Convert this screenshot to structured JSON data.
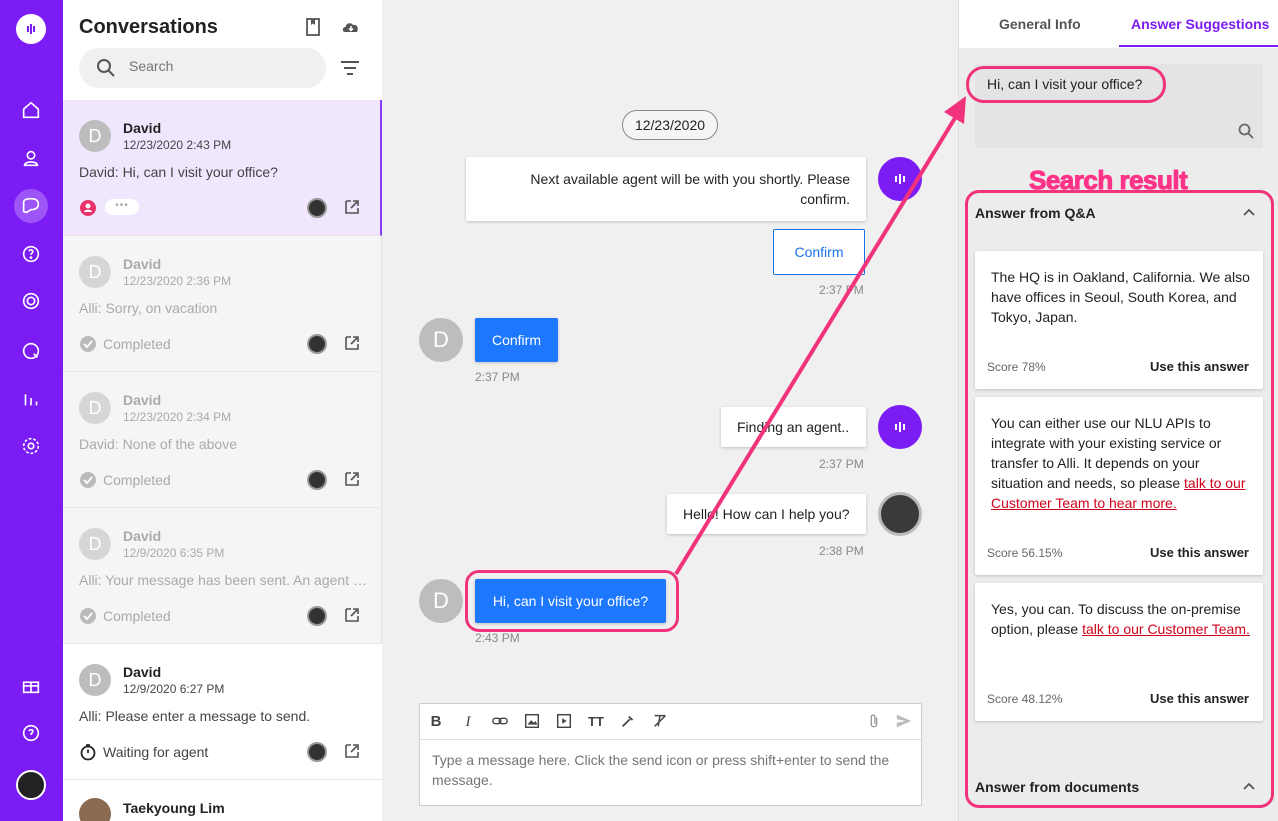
{
  "rail": {
    "icons": [
      "logo-icon",
      "home-icon",
      "user-icon",
      "conversations-icon",
      "help-bubble-icon",
      "target-icon",
      "search-chat-icon",
      "bar-chart-icon",
      "gear-icon",
      "gift-icon",
      "help-icon",
      "avatar"
    ]
  },
  "conversations": {
    "title": "Conversations",
    "search_placeholder": "Search",
    "items": [
      {
        "avatar": "D",
        "name": "David",
        "time": "12/23/2020 2:43 PM",
        "message": "David: Hi, can I visit your office?",
        "status": "",
        "typing": "•••"
      },
      {
        "avatar": "D",
        "name": "David",
        "time": "12/23/2020 2:36 PM",
        "message": "Alli: Sorry, on vacation",
        "status": "Completed"
      },
      {
        "avatar": "D",
        "name": "David",
        "time": "12/23/2020 2:34 PM",
        "message": "David: None of the above",
        "status": "Completed"
      },
      {
        "avatar": "D",
        "name": "David",
        "time": "12/9/2020 6:35 PM",
        "message": "Alli: Your message has been sent. An agent will be with you shortly.",
        "status": "Completed"
      },
      {
        "avatar": "D",
        "name": "David",
        "time": "12/9/2020 6:27 PM",
        "message": "Alli: Please enter a message to send.",
        "status": "Waiting for agent"
      },
      {
        "name": "Taekyoung Lim"
      }
    ]
  },
  "chat": {
    "date": "12/23/2020",
    "bot_msg_1": "Next available agent will be with you shortly. Please confirm.",
    "confirm_option": "Confirm",
    "ts_1": "2:37 PM",
    "user_avatar": "D",
    "user_confirm": "Confirm",
    "ts_2": "2:37 PM",
    "bot_msg_2": "Finding an agent..",
    "ts_3": "2:37 PM",
    "agent_msg": "Hello! How can I help you?",
    "ts_4": "2:38 PM",
    "user_msg": "Hi, can I visit your office?",
    "ts_5": "2:43 PM",
    "composer_placeholder": "Type a message here. Click the send icon or press shift+enter to send the message."
  },
  "side": {
    "tab_general": "General Info",
    "tab_suggestions": "Answer Suggestions",
    "query": "Hi, can I visit your office?",
    "annotation_label": "Search result",
    "qa_header": "Answer from Q&A",
    "docs_header": "Answer from documents",
    "use_label": "Use this answer",
    "answers": [
      {
        "text": "The HQ is in Oakland, California. We also have offices in Seoul, South Korea, and Tokyo, Japan.",
        "link": "",
        "score": "Score 78%"
      },
      {
        "text": "You can either use our NLU APIs to integrate with your existing service or transfer to Alli. It depends on your situation and needs, so please ",
        "link": "talk to our Customer Team to hear more.",
        "score": "Score 56.15%"
      },
      {
        "text": "Yes, you can. To discuss the on-premise option, please ",
        "link": "talk to our Customer Team.",
        "score": "Score 48.12%"
      }
    ]
  },
  "colors": {
    "brand": "#7c1cf5",
    "primary_blue": "#1e78ff",
    "annotation": "#f0337a",
    "link_red": "#d0021b"
  }
}
